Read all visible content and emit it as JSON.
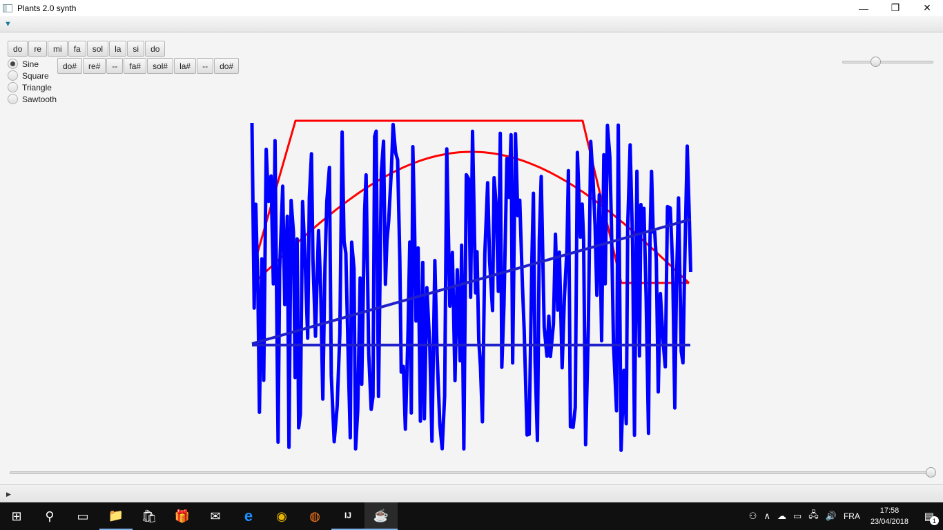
{
  "window": {
    "title": "Plants 2.0 synth",
    "minimize_glyph": "—",
    "restore_glyph": "❐",
    "close_glyph": "✕"
  },
  "menu": {
    "toggle_glyph": "▼"
  },
  "notes": {
    "naturals": [
      "do",
      "re",
      "mi",
      "fa",
      "sol",
      "la",
      "si",
      "do"
    ],
    "sharps": [
      "do#",
      "re#",
      "--",
      "fa#",
      "sol#",
      "la#",
      "--",
      "do#"
    ]
  },
  "waveforms": {
    "options": [
      "Sine",
      "Square",
      "Triangle",
      "Sawtooth"
    ],
    "selected": "Sine"
  },
  "volume_slider": {
    "value": 0.35
  },
  "position_slider": {
    "value": 1.0
  },
  "plot": {
    "colors": {
      "noise": "#0000ff",
      "ramp": "#1f1fcc",
      "envelope": "#ff0000"
    }
  },
  "bottom": {
    "toggle_glyph": "▶"
  },
  "taskbar": {
    "icons": [
      {
        "name": "windows-start-icon",
        "glyph": "⊞"
      },
      {
        "name": "search-icon",
        "glyph": "⚲"
      },
      {
        "name": "task-view-icon",
        "glyph": "▭"
      },
      {
        "name": "file-explorer-icon",
        "glyph": "📁"
      },
      {
        "name": "store-icon",
        "glyph": "🛍"
      },
      {
        "name": "gift-icon",
        "glyph": "🎁"
      },
      {
        "name": "mail-icon",
        "glyph": "✉"
      },
      {
        "name": "edge-icon",
        "glyph": "e"
      },
      {
        "name": "chrome-icon",
        "glyph": "◉"
      },
      {
        "name": "firefox-icon",
        "glyph": "◍"
      },
      {
        "name": "intellij-icon",
        "glyph": "IJ"
      },
      {
        "name": "java-icon",
        "glyph": "☕"
      }
    ],
    "tray": {
      "people_glyph": "⚇",
      "chevron_glyph": "∧",
      "onedrive_glyph": "☁",
      "battery_glyph": "▭",
      "network_glyph": "🖧",
      "volume_glyph": "🔊",
      "language": "FRA",
      "time": "17:58",
      "date": "23/04/2018",
      "notification_glyph": "▤",
      "notification_count": "1"
    }
  }
}
